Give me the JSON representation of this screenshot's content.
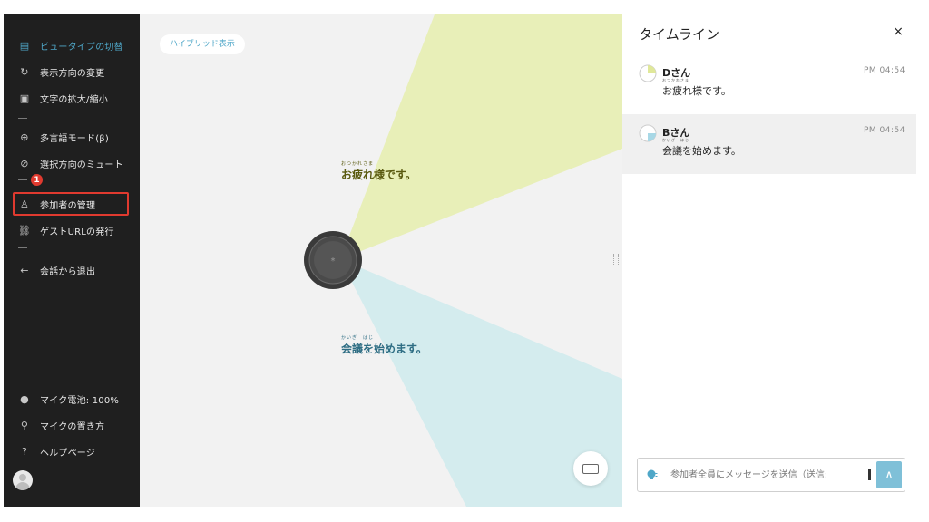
{
  "colors": {
    "accent": "#4fa7c8",
    "highlight": "#e03a2f",
    "yellow_wedge": "#e8efb8",
    "blue_wedge": "#d4ecee",
    "sidebar_bg": "#1f1f1f"
  },
  "sidebar": {
    "items": [
      {
        "label": "ビュータイプの切替",
        "icon": "view-switch-icon",
        "glyph": "▤"
      },
      {
        "label": "表示方向の変更",
        "icon": "rotate-icon",
        "glyph": "↻"
      },
      {
        "label": "文字の拡大/縮小",
        "icon": "text-size-icon",
        "glyph": "▣"
      },
      {
        "label": "多言語モード(β)",
        "icon": "globe-icon",
        "glyph": "⊕"
      },
      {
        "label": "選択方向のミュート",
        "icon": "mute-icon",
        "glyph": "⊘"
      },
      {
        "label": "参加者の管理",
        "icon": "person-icon",
        "glyph": "♙"
      },
      {
        "label": "ゲストURLの発行",
        "icon": "link-icon",
        "glyph": "⛓"
      },
      {
        "label": "会話から退出",
        "icon": "arrow-left-icon",
        "glyph": "←"
      },
      {
        "label": "マイク電池: 100%",
        "icon": "battery-icon",
        "glyph": "●"
      },
      {
        "label": "マイクの置き方",
        "icon": "mic-icon",
        "glyph": "⚲"
      },
      {
        "label": "ヘルプページ",
        "icon": "help-icon",
        "glyph": "?"
      }
    ],
    "callout_number": "1"
  },
  "main": {
    "mode_label": "ハイブリッド表示",
    "bubble_top": {
      "ruby": "おつかれさま",
      "text": "お疲れ様です。"
    },
    "bubble_bottom": {
      "ruby": "かいぎ　はじ",
      "text": "会議を始めます。"
    }
  },
  "timeline": {
    "title": "タイムライン",
    "close": "×",
    "messages": [
      {
        "speaker": "Dさん",
        "time": "PM 04:54",
        "ruby": "おつかれさま",
        "text": "お疲れ様です。"
      },
      {
        "speaker": "Bさん",
        "time": "PM 04:54",
        "ruby": "かいぎ　はじ",
        "text": "会議を始めます。"
      }
    ],
    "composer": {
      "placeholder": "参加者全員にメッセージを送信（送信:",
      "send": "∧"
    }
  }
}
